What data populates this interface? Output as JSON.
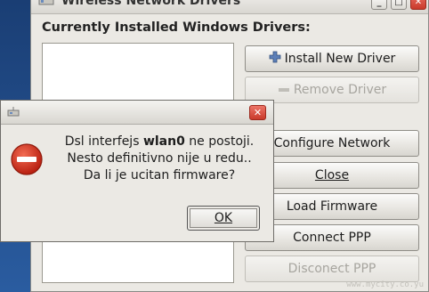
{
  "main_window": {
    "title": "Wireless Network Drivers",
    "section_label": "Currently Installed Windows Drivers:",
    "buttons": {
      "install": "Install New Driver",
      "remove": "Remove Driver",
      "configure": "Configure Network",
      "close": "Close",
      "load_firmware": "Load Firmware",
      "connect_ppp": "Connect PPP",
      "disconnect_ppp": "Disconect PPP"
    },
    "titlebar_buttons": {
      "minimize": "_",
      "maximize": "□",
      "close": "✕"
    }
  },
  "dialog": {
    "message_prefix": "Dsl interfejs ",
    "interface_name": "wlan0",
    "message_suffix": " ne postoji.",
    "line2": "Nesto definitivno nije u redu..",
    "line3": "Da li je ucitan firmware?",
    "ok_label": "OK",
    "close_glyph": "✕"
  },
  "icons": {
    "install": "plus-icon",
    "remove": "minus-icon",
    "dialog_error": "error-icon"
  },
  "colors": {
    "error_red": "#d8321f",
    "close_red": "#c93a2b"
  },
  "watermark": "www.mycity.co.yu"
}
